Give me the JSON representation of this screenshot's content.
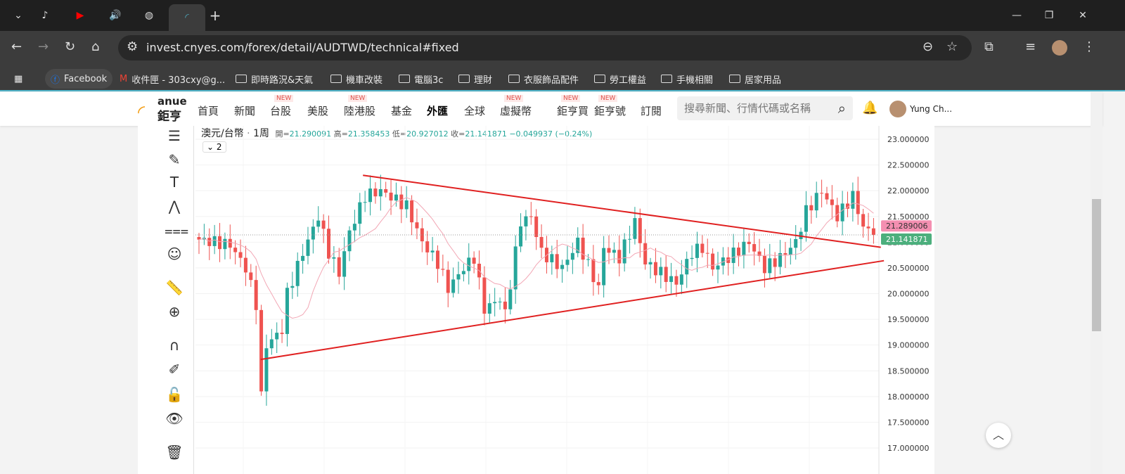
{
  "browser": {
    "url": "invest.cnyes.com/forex/detail/AUDTWD/technical#fixed",
    "bookmarks": [
      "Facebook",
      "收件匣 - 303cxy@g...",
      "即時路況&天氣",
      "機車改裝",
      "電腦3c",
      "理財",
      "衣服飾品配件",
      "勞工權益",
      "手機相關",
      "居家用品"
    ]
  },
  "site": {
    "logo_en": "anue",
    "logo_zh": "鉅亨",
    "nav": [
      {
        "label": "首頁"
      },
      {
        "label": "新聞"
      },
      {
        "label": "台股",
        "badge": "NEW"
      },
      {
        "label": "美股"
      },
      {
        "label": "陸港股",
        "badge": "NEW"
      },
      {
        "label": "基金"
      },
      {
        "label": "外匯",
        "active": true
      },
      {
        "label": "全球"
      },
      {
        "label": "虛擬幣",
        "badge": "NEW"
      },
      {
        "label": "鉅亨買",
        "badge": "NEW"
      },
      {
        "label": "鉅亨號",
        "badge": "NEW"
      },
      {
        "label": "訂閱"
      }
    ],
    "search_placeholder": "搜尋新聞、行情代碼或名稱",
    "user": "Yung Ch..."
  },
  "chart": {
    "symbol": "澳元/台幣",
    "interval": "1周",
    "ohlc": {
      "open_label": "開=",
      "open": "21.290091",
      "high_label": "高=",
      "high": "21.358453",
      "low_label": "低=",
      "low": "20.927012",
      "close_label": "收=",
      "close": "21.141871",
      "change": "−0.049937 (−0.24%)"
    },
    "indicators_toggle": "2",
    "tags": {
      "ma": "21.289006",
      "last": "21.141871"
    },
    "colors": {
      "up": "#26a69a",
      "down": "#ef5350",
      "tag_ma": "#f48fb1",
      "tag_last": "#4caf7d",
      "trend": "#e02020",
      "ma": "#f2a7b5"
    }
  },
  "chart_data": {
    "type": "candlestick",
    "yticks": [
      "23.000000",
      "22.500000",
      "22.000000",
      "21.500000",
      "21.000000",
      "20.500000",
      "20.000000",
      "19.500000",
      "19.000000",
      "18.500000",
      "18.000000",
      "17.500000",
      "17.000000"
    ],
    "ylim": [
      17.0,
      23.0
    ],
    "n_candles": 131,
    "close_anchors": [
      [
        0,
        21.05
      ],
      [
        6,
        20.95
      ],
      [
        9,
        20.5
      ],
      [
        11,
        19.8
      ],
      [
        12,
        18.0
      ],
      [
        13,
        19.0
      ],
      [
        16,
        19.3
      ],
      [
        17,
        20.0
      ],
      [
        20,
        20.8
      ],
      [
        23,
        21.5
      ],
      [
        25,
        20.8
      ],
      [
        27,
        20.4
      ],
      [
        29,
        21.2
      ],
      [
        32,
        21.9
      ],
      [
        35,
        22.0
      ],
      [
        40,
        21.7
      ],
      [
        43,
        21.0
      ],
      [
        46,
        20.6
      ],
      [
        48,
        20.1
      ],
      [
        51,
        20.5
      ],
      [
        53,
        20.7
      ],
      [
        55,
        19.7
      ],
      [
        58,
        19.9
      ],
      [
        59,
        19.6
      ],
      [
        62,
        21.4
      ],
      [
        64,
        21.5
      ],
      [
        66,
        20.8
      ],
      [
        70,
        20.5
      ],
      [
        73,
        21.0
      ],
      [
        77,
        20.1
      ],
      [
        78,
        20.9
      ],
      [
        81,
        20.7
      ],
      [
        84,
        21.4
      ],
      [
        86,
        20.6
      ],
      [
        89,
        20.4
      ],
      [
        92,
        20.2
      ],
      [
        95,
        20.8
      ],
      [
        97,
        20.9
      ],
      [
        99,
        20.5
      ],
      [
        102,
        20.7
      ],
      [
        106,
        21.0
      ],
      [
        109,
        20.5
      ],
      [
        112,
        20.7
      ],
      [
        115,
        21.0
      ],
      [
        117,
        21.6
      ],
      [
        120,
        22.0
      ],
      [
        123,
        21.5
      ],
      [
        126,
        21.9
      ],
      [
        128,
        21.3
      ],
      [
        130,
        21.14
      ]
    ],
    "trendlines": [
      {
        "name": "upper",
        "from": [
          31.6,
          22.3
        ],
        "to": [
          131.4,
          20.9
        ]
      },
      {
        "name": "lower",
        "from": [
          11.9,
          18.72
        ],
        "to": [
          132,
          20.64
        ]
      }
    ]
  }
}
